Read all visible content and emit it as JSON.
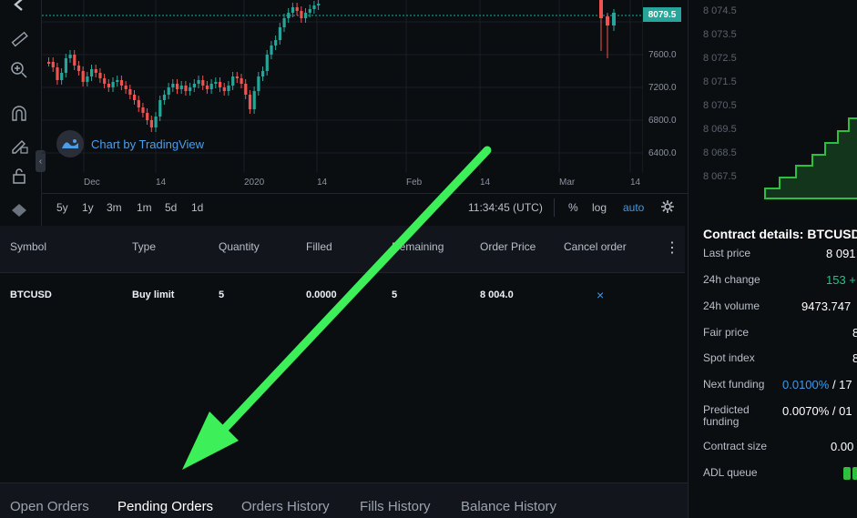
{
  "chart": {
    "last_price_tag": "8079.5",
    "y_axis": [
      "7600.0",
      "7200.0",
      "6800.0",
      "6400.0"
    ],
    "x_axis": [
      "Dec",
      "14",
      "2020",
      "14",
      "Feb",
      "14",
      "Mar",
      "14"
    ],
    "brand": "Chart by TradingView",
    "collapse_glyph": "‹",
    "ranges": [
      "5y",
      "1y",
      "3m",
      "1m",
      "5d",
      "1d"
    ],
    "clock": "11:34:45 (UTC)",
    "percent_label": "%",
    "log_label": "log",
    "auto_label": "auto",
    "colors": {
      "up": "#26a69a",
      "down": "#ef5350",
      "accent": "#3d9ae8"
    }
  },
  "orders": {
    "columns": [
      "Symbol",
      "Type",
      "Quantity",
      "Filled",
      "Remaining",
      "Order Price",
      "Cancel order"
    ],
    "rows": [
      {
        "symbol": "BTCUSD",
        "type": "Buy limit",
        "quantity": "5",
        "filled": "0.0000",
        "remaining": "5",
        "price": "8 004.0",
        "cancel": "×"
      }
    ],
    "menu_glyph": "⋮"
  },
  "tabs": [
    "Open Orders",
    "Pending Orders",
    "Orders History",
    "Fills History",
    "Balance History"
  ],
  "active_tab": "Pending Orders",
  "depth": {
    "price_labels": [
      "8 074.5",
      "8 073.5",
      "8 072.5",
      "8 071.5",
      "8 070.5",
      "8 069.5",
      "8 068.5",
      "8 067.5"
    ],
    "color": "#2fbf3f"
  },
  "contract": {
    "title": "Contract details: BTCUSD",
    "rows": [
      {
        "label": "Last price",
        "value": "8 091"
      },
      {
        "label": "24h change",
        "value": "153 +"
      },
      {
        "label": "24h volume",
        "value": "9473.747"
      },
      {
        "label": "Fair price",
        "value": "8"
      },
      {
        "label": "Spot index",
        "value": "8"
      },
      {
        "label": "Next funding",
        "value": "0.0100%",
        "value_suffix": " / 17"
      },
      {
        "label": "Predicted funding",
        "value": "0.0070% / 01"
      },
      {
        "label": "Contract size",
        "value": "0.00"
      },
      {
        "label": "ADL queue",
        "value": ""
      }
    ]
  },
  "annotation": {
    "color": "#3df05a"
  }
}
